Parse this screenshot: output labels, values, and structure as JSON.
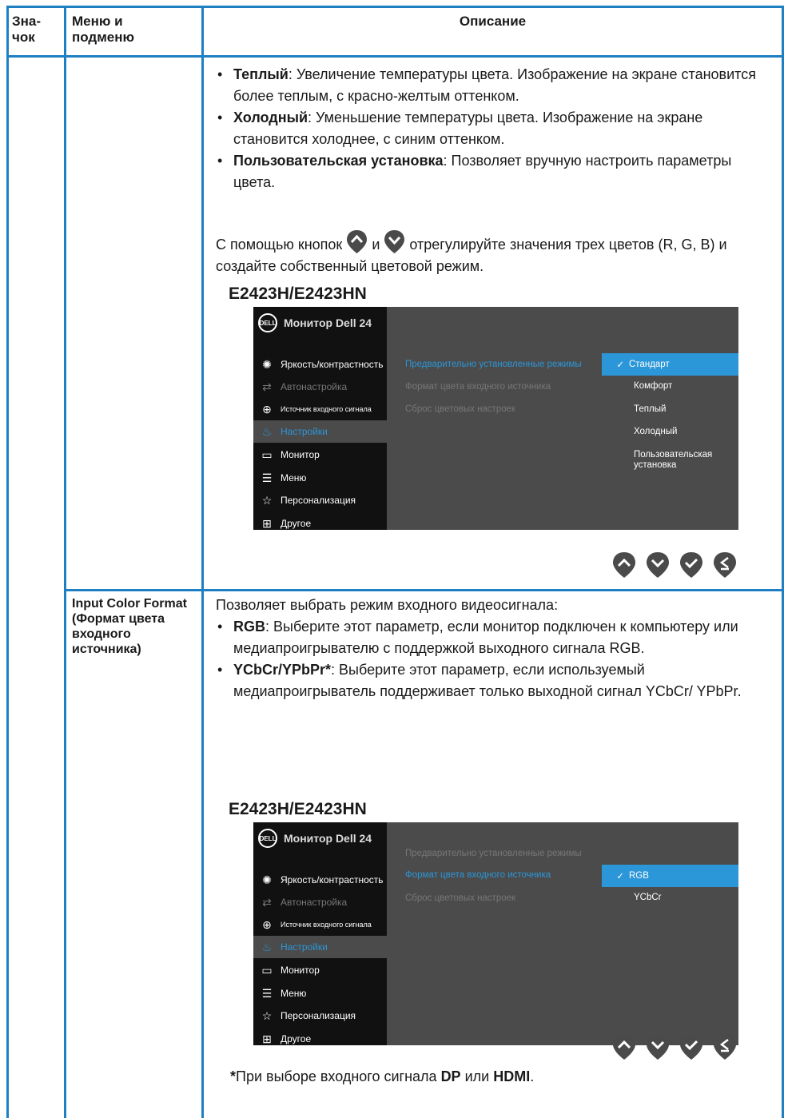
{
  "header": {
    "icon_col": "Зна-\nчок",
    "menu_col": "Меню и подменю",
    "desc_col": "Описание"
  },
  "row1": {
    "bullets": [
      {
        "term": "Теплый",
        "text": ": Увеличение температуры цвета. Изображение на экране становится более теплым, с красно-желтым оттенком."
      },
      {
        "term": "Холодный",
        "text": ": Уменьшение температуры цвета. Изображение на экране становится холоднее, с синим оттенком."
      },
      {
        "term": "Пользовательская установка",
        "text": ": Позволяет вручную настроить параметры цвета."
      }
    ],
    "para_before": "С помощью кнопок",
    "para_and": "и",
    "para_after": "отрегулируйте значения трех цветов (R, G, B) и создайте собственный цветовой режим.",
    "model": "E2423H/E2423HN",
    "osd": {
      "brand": "DELL",
      "title": "Монитор Dell 24",
      "menu": [
        {
          "icon": "brightness-icon",
          "label": "Яркость/контрастность"
        },
        {
          "icon": "auto-adjust-icon",
          "label": "Автонастройка"
        },
        {
          "icon": "input-source-icon",
          "label": "Источник входного сигнала"
        },
        {
          "icon": "color-icon",
          "label": "Настройки"
        },
        {
          "icon": "monitor-icon",
          "label": "Монитор"
        },
        {
          "icon": "menu-icon",
          "label": "Меню"
        },
        {
          "icon": "star-icon",
          "label": "Персонализация"
        },
        {
          "icon": "other-icon",
          "label": "Другое"
        }
      ],
      "submenu": [
        "Предварительно установленные режимы",
        "Формат цвета входного источника",
        "Сброс цветовых настроек"
      ],
      "options": [
        "Стандарт",
        "Комфорт",
        "Теплый",
        "Холодный",
        "Пользовательская\nустановка"
      ]
    }
  },
  "row2": {
    "menu_label": "Input Color Format (Формат цвета входного источника)",
    "intro": "Позволяет выбрать режим входного видеосигнала:",
    "bullets": [
      {
        "term": "RGB",
        "text": ": Выберите этот параметр, если монитор подключен к компьютеру или медиапроигрывателю с поддержкой выходного сигнала RGB."
      },
      {
        "term": "YCbCr/YPbPr*",
        "text": ": Выберите этот параметр, если используемый медиапроигрыватель поддерживает только выходной сигнал YCbCr/ YPbPr."
      }
    ],
    "model": "E2423H/E2423HN",
    "osd": {
      "brand": "DELL",
      "title": "Монитор Dell 24",
      "options": [
        "RGB",
        "YCbCr"
      ]
    },
    "footnote": {
      "star": "*",
      "pre": "При выборе входного сигнала ",
      "dp": "DP",
      "mid": " или ",
      "hdmi": "HDMI",
      "end": "."
    }
  },
  "colors": {
    "frame": "#1e7fc2",
    "osd_accent": "#2b96d8",
    "osd_bg": "#4b4b4b",
    "osd_left": "#111111"
  }
}
